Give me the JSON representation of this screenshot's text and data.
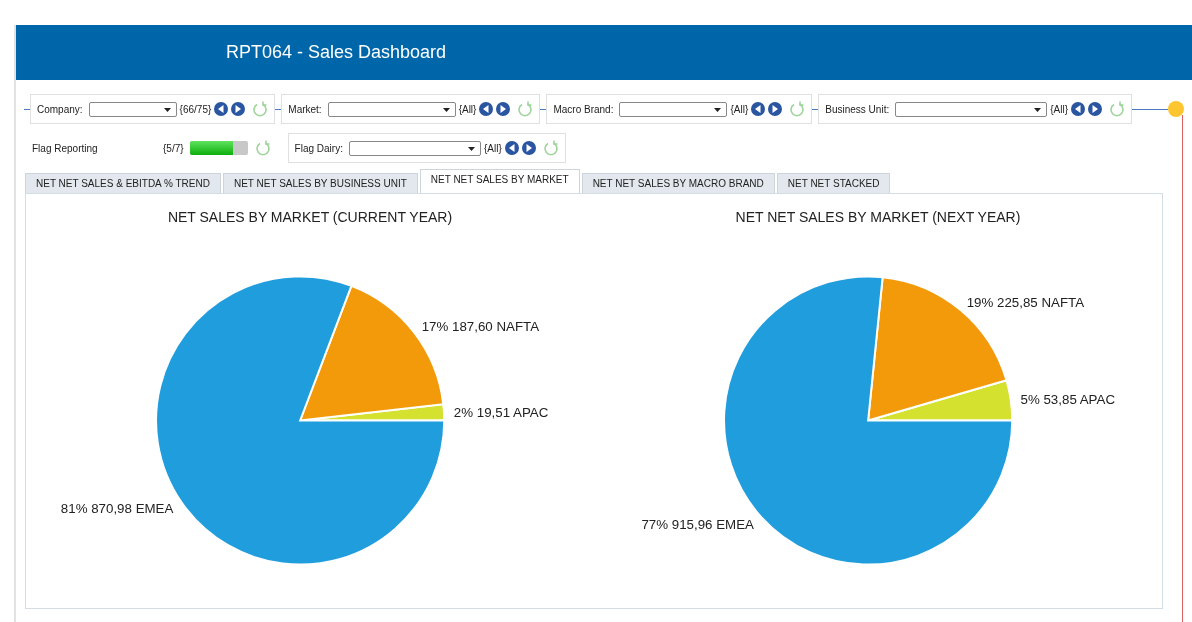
{
  "header": {
    "title": "RPT064 - Sales Dashboard"
  },
  "filters": [
    {
      "label": "Company:",
      "count": "{66/75}"
    },
    {
      "label": "Market:",
      "count": "{All}"
    },
    {
      "label": "Macro Brand:",
      "count": "{All}"
    },
    {
      "label": "Business Unit:",
      "count": "{All}"
    }
  ],
  "flag_reporting": {
    "label": "Flag Reporting",
    "count": "{5/7}",
    "level": 0.75
  },
  "flag_dairy": {
    "label": "Flag Dairy:",
    "count": "{All}"
  },
  "tabs": [
    {
      "label": "NET NET SALES & EBITDA % TREND",
      "selected": false
    },
    {
      "label": "NET NET SALES BY BUSINESS UNIT",
      "selected": false
    },
    {
      "label": "NET NET SALES BY MARKET",
      "selected": true
    },
    {
      "label": "NET NET SALES BY MACRO BRAND",
      "selected": false
    },
    {
      "label": "NET NET STACKED",
      "selected": false
    }
  ],
  "charts": [
    {
      "chart_data": {
        "type": "pie",
        "title": "NET SALES BY MARKET (CURRENT YEAR)",
        "categories": [
          "APAC",
          "NAFTA",
          "EMEA"
        ],
        "values": [
          19.51,
          187.6,
          870.98
        ],
        "colors": [
          "#d4e12f",
          "#f39a0a",
          "#1f9ddc"
        ],
        "value_labels": [
          "2% 19,51",
          "17% 187,60",
          "81% 870,98"
        ]
      }
    },
    {
      "chart_data": {
        "type": "pie",
        "title": "NET NET SALES BY MARKET (NEXT YEAR)",
        "categories": [
          "APAC",
          "NAFTA",
          "EMEA"
        ],
        "values": [
          53.85,
          225.85,
          915.96
        ],
        "colors": [
          "#d4e12f",
          "#f39a0a",
          "#1f9ddc"
        ],
        "value_labels": [
          "5% 53,85",
          "19% 225,85",
          "77% 915,96"
        ]
      }
    }
  ]
}
